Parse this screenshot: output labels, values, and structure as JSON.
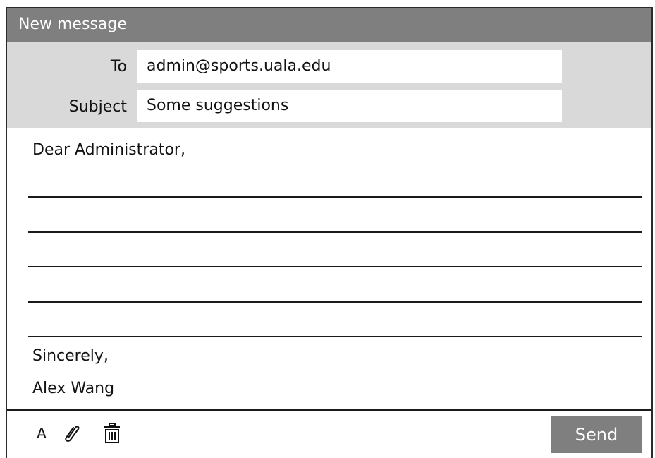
{
  "window": {
    "title": "New message"
  },
  "fields": {
    "to": {
      "label": "To",
      "value": "admin@sports.uala.edu"
    },
    "subject": {
      "label": "Subject",
      "value": "Some suggestions"
    }
  },
  "message": {
    "greeting": "Dear Administrator,",
    "closing": "Sincerely,",
    "signature": "Alex Wang"
  },
  "toolbar": {
    "font_label": "A",
    "attach_icon": "paperclip-icon",
    "delete_icon": "trash-icon",
    "send_label": "Send"
  },
  "colors": {
    "titlebar": "#7f7f7f",
    "header_fields_bg": "#d9d9d9",
    "field_bg": "#ffffff",
    "send_button": "#7f7f7f"
  }
}
